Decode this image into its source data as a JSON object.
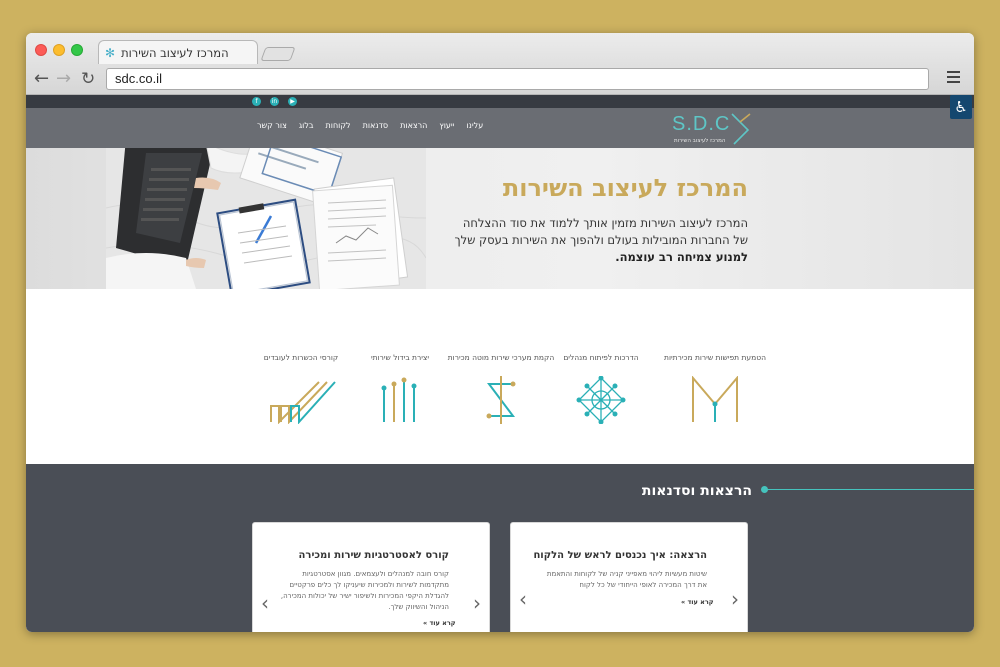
{
  "browser": {
    "tab_title": "המרכז לעיצוב השירות",
    "url": "sdc.co.il"
  },
  "site": {
    "logo_text": "S.D.C",
    "logo_sub": "המרכז לעיצוב השירות",
    "menu": [
      "עלינו",
      "ייעוץ",
      "הרצאות",
      "סדנאות",
      "לקוחות",
      "בלוג",
      "צור קשר"
    ],
    "social": [
      "f",
      "in",
      "yt"
    ]
  },
  "hero": {
    "title": "המרכז לעיצוב השירות",
    "line1": "המרכז לעיצוב השירות מזמין אותך ללמוד את סוד ההצלחה",
    "line2": "של החברות המובילות בעולם ולהפוך את השירות בעסק שלך",
    "line3": "למנוע צמיחה רב עוצמה."
  },
  "services": [
    {
      "label": "הטמעת תפישות שירות מכירתיות",
      "icon": "m-shape-icon"
    },
    {
      "label": "הדרכות לפיתוח מנהלים",
      "icon": "network-icon"
    },
    {
      "label": "הקמת מערכי שירות מוטה מכירות",
      "icon": "dollar-icon"
    },
    {
      "label": "יצירת בידול שירותי",
      "icon": "bars-icon"
    },
    {
      "label": "קורסי הכשרות לעובדים",
      "icon": "lines-icon"
    }
  ],
  "talks": {
    "title": "הרצאות וסדנאות",
    "cards": [
      {
        "title": "הרצאה: איך נכנסים לראש של הלקוח",
        "text": "שיטות מעשיות ליהוי מאפייני קניה של לקוחות והתאמת את דרך המכירה לאופי הייחודי של כל לקוח",
        "more": "קרא עוד »"
      },
      {
        "title": "קורס לאסטרטגיות שירות ומכירה",
        "text": "קורס חובה למנהלים ולעצמאים. מגוון אסטרטגיות מתקדמות לשירות ולמכירות שיעניקו לך כלים פרקטיים להגדלת היקפי המכירות ולשיפור ישיר של יכולות המכירה, הניהול והשיווק שלך.",
        "more": "קרא עוד »"
      }
    ]
  },
  "colors": {
    "gold": "#c9a95b",
    "teal": "#2ab0b6",
    "dark": "#4a4e56",
    "background": "#cdb260"
  }
}
